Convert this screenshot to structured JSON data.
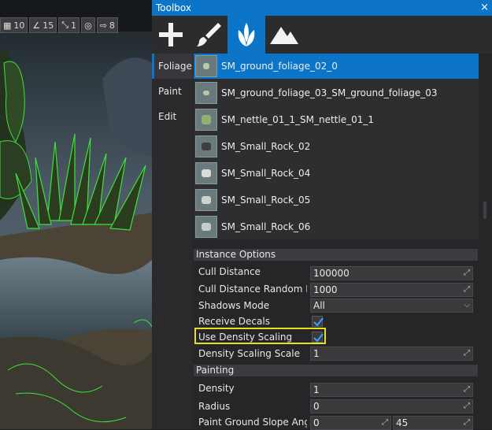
{
  "viewport": {
    "toolbar": [
      {
        "icon": "grid-icon",
        "value": "10"
      },
      {
        "icon": "angle-icon",
        "value": "15"
      },
      {
        "icon": "scale-icon",
        "value": "1"
      },
      {
        "icon": "globe-icon",
        "value": ""
      },
      {
        "icon": "camera-speed-icon",
        "value": "8"
      }
    ]
  },
  "toolbox": {
    "title": "Toolbox",
    "close": "×",
    "tools": [
      "add-icon",
      "paint-brush-icon",
      "foliage-icon",
      "terrain-icon"
    ],
    "tabs": [
      "Foliage",
      "Paint",
      "Edit"
    ],
    "assets": [
      "SM_ground_foliage_02_0",
      "SM_ground_foliage_03_SM_ground_foliage_03",
      "SM_nettle_01_1_SM_nettle_01_1",
      "SM_Small_Rock_02",
      "SM_Small_Rock_04",
      "SM_Small_Rock_05",
      "SM_Small_Rock_06"
    ],
    "instance_options": {
      "header": "Instance Options",
      "cull_distance_label": "Cull Distance",
      "cull_distance_value": "100000",
      "cull_random_label": "Cull Distance Random Ra",
      "cull_random_value": "1000",
      "shadows_label": "Shadows Mode",
      "shadows_value": "All",
      "receive_decals_label": "Receive Decals",
      "receive_decals_checked": true,
      "density_scaling_label": "Use Density Scaling",
      "density_scaling_checked": true,
      "density_scale_label": "Density Scaling Scale",
      "density_scale_value": "1"
    },
    "painting": {
      "header": "Painting",
      "density_label": "Density",
      "density_value": "1",
      "radius_label": "Radius",
      "radius_value": "0",
      "slope_label": "Paint Ground Slope Angle",
      "slope_min": "0",
      "slope_max": "45"
    }
  }
}
